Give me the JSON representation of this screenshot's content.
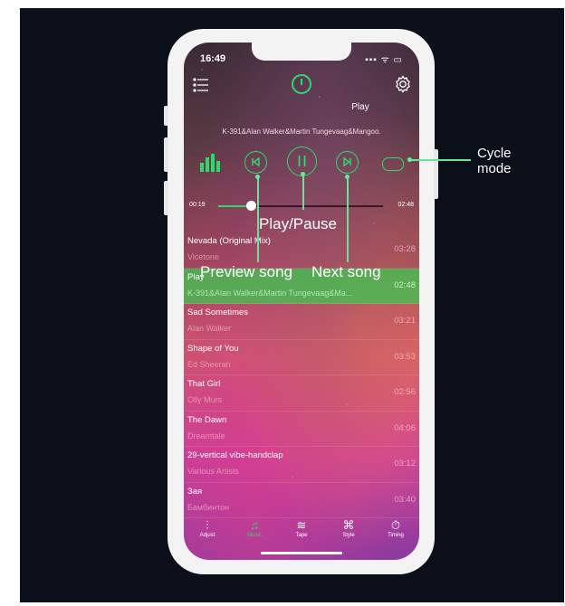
{
  "status": {
    "time": "16:49",
    "indicators": "▪▪▪ ᯤ ▭"
  },
  "header": {
    "now_playing_label": "Play",
    "artist_line": "K-391&Alan Walker&Martin Tungevaag&Mangoo."
  },
  "player": {
    "elapsed": "00:19",
    "duration": "02:48",
    "progress_fraction": 0.2
  },
  "callouts": {
    "play_pause": "Play/Pause",
    "preview": "Preview song",
    "next": "Next song",
    "cycle": "Cycle\nmode"
  },
  "songs": [
    {
      "title": "Nevada (Original Mix)",
      "artist": "Vicetone",
      "duration": "03:28",
      "active": false
    },
    {
      "title": "Play",
      "artist": "K-391&Alan Walker&Martin Tungevaag&Ma...",
      "duration": "02:48",
      "active": true
    },
    {
      "title": "Sad Sometimes",
      "artist": "Alan Walker",
      "duration": "03:21",
      "active": false
    },
    {
      "title": "Shape of You",
      "artist": "Ed Sheeran",
      "duration": "03:53",
      "active": false
    },
    {
      "title": "That Girl",
      "artist": "Olly Murs",
      "duration": "02:56",
      "active": false
    },
    {
      "title": "The Dawn",
      "artist": "Dreamtale",
      "duration": "04:06",
      "active": false
    },
    {
      "title": "29-vertical vibe-handclap",
      "artist": "Various Artists",
      "duration": "03:12",
      "active": false
    },
    {
      "title": "Зая",
      "artist": "Бамбинтон",
      "duration": "03:40",
      "active": false
    }
  ],
  "tabs": [
    {
      "label": "Adjust",
      "icon": "sliders-icon",
      "active": false
    },
    {
      "label": "Music",
      "icon": "music-note-icon",
      "active": true
    },
    {
      "label": "Tape",
      "icon": "tape-wave-icon",
      "active": false
    },
    {
      "label": "Style",
      "icon": "command-icon",
      "active": false
    },
    {
      "label": "Timing",
      "icon": "timer-icon",
      "active": false
    }
  ],
  "colors": {
    "accent": "#2fd86c",
    "background": "#0b0f1a",
    "active_row": "#3cc850"
  }
}
